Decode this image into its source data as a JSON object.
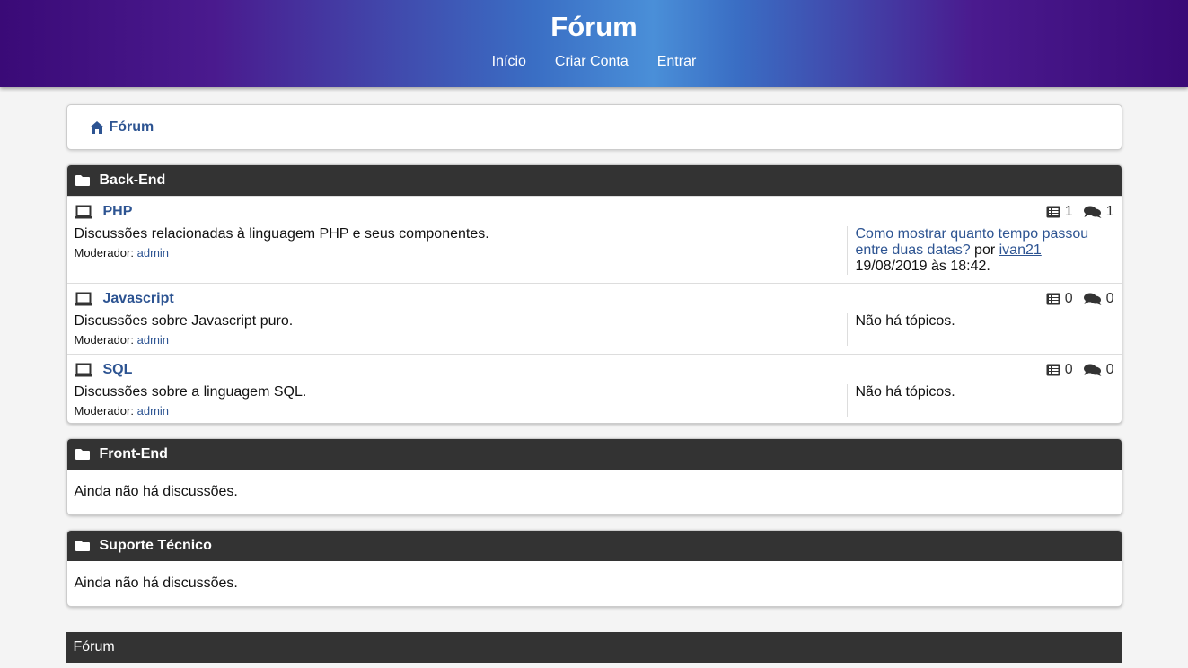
{
  "header": {
    "title": "Fórum",
    "nav": [
      "Início",
      "Criar Conta",
      "Entrar"
    ]
  },
  "breadcrumb": {
    "label": "Fórum"
  },
  "sections": {
    "backend": {
      "title": "Back-End",
      "forums": [
        {
          "name": "PHP",
          "description": "Discussões relacionadas à linguagem PHP e seus componentes.",
          "moderator_label": "Moderador:",
          "moderator": "admin",
          "topics_count": "1",
          "posts_count": "1",
          "last_topic": "Como mostrar quanto tempo passou entre duas datas?",
          "by_label": "por",
          "last_user": "ivan21",
          "last_date": "19/08/2019 às 18:42."
        },
        {
          "name": "Javascript",
          "description": "Discussões sobre Javascript puro.",
          "moderator_label": "Moderador:",
          "moderator": "admin",
          "topics_count": "0",
          "posts_count": "0",
          "no_topics": "Não há tópicos."
        },
        {
          "name": "SQL",
          "description": "Discussões sobre a linguagem SQL.",
          "moderator_label": "Moderador:",
          "moderator": "admin",
          "topics_count": "0",
          "posts_count": "0",
          "no_topics": "Não há tópicos."
        }
      ]
    },
    "frontend": {
      "title": "Front-End",
      "empty": "Ainda não há discussões."
    },
    "support": {
      "title": "Suporte Técnico",
      "empty": "Ainda não há discussões."
    }
  },
  "footer": {
    "label": "Fórum"
  },
  "colors": {
    "link": "#2d5492",
    "panel_header": "#333333",
    "gradient_edge": "#3a0a77",
    "gradient_center": "#4a8fd8"
  }
}
